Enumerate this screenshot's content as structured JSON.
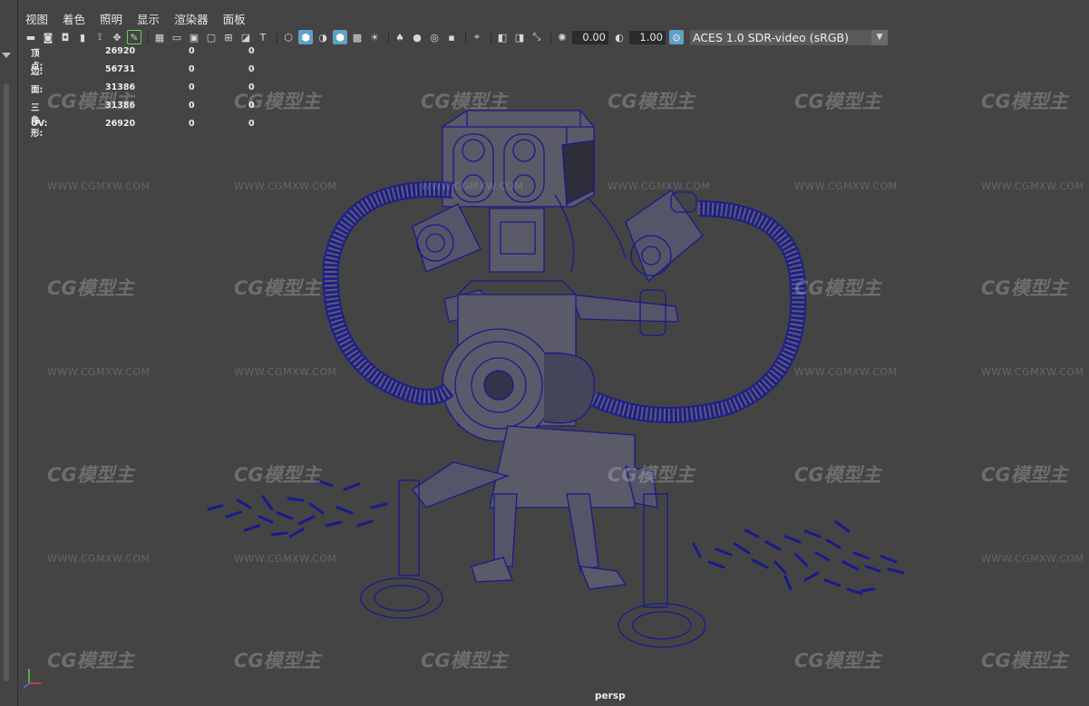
{
  "menu": [
    "视图",
    "着色",
    "照明",
    "显示",
    "渲染器",
    "面板"
  ],
  "toolbar": {
    "exposure": "0.00",
    "gamma": "1.00",
    "color_space": "ACES 1.0 SDR-video (sRGB)"
  },
  "hud": {
    "rows": [
      {
        "label": "顶点:",
        "v1": "26920",
        "v2": "0",
        "v3": "0"
      },
      {
        "label": "边:",
        "v1": "56731",
        "v2": "0",
        "v3": "0"
      },
      {
        "label": "面:",
        "v1": "31386",
        "v2": "0",
        "v3": "0"
      },
      {
        "label": "三角形:",
        "v1": "31386",
        "v2": "0",
        "v3": "0"
      },
      {
        "label": "UV:",
        "v1": "26920",
        "v2": "0",
        "v3": "0"
      }
    ]
  },
  "watermark": {
    "logo": "CG模型主",
    "url": "WWW.CGMXW.COM"
  },
  "camera_label": "persp",
  "colors": {
    "viewport_bg": "#444444",
    "wire": "#1a1a8c",
    "highlight": "#5fa0c8"
  }
}
